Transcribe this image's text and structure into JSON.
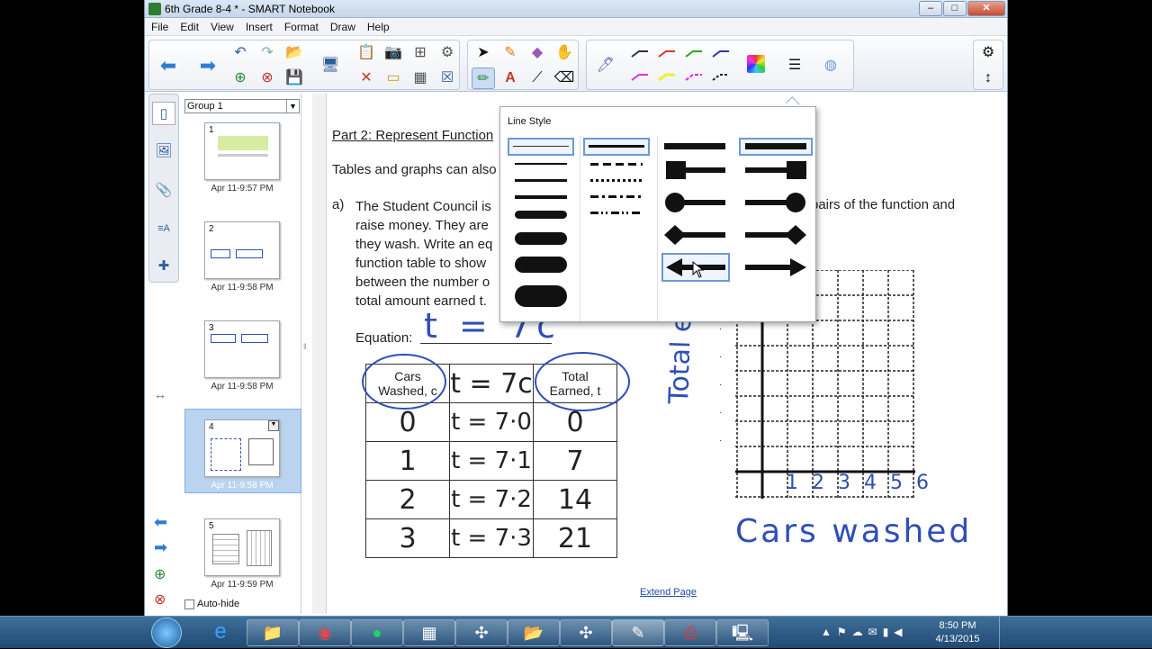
{
  "window": {
    "title": "6th Grade 8-4 * - SMART Notebook",
    "min": "–",
    "max": "□",
    "close": "✕"
  },
  "menu": [
    "File",
    "Edit",
    "View",
    "Insert",
    "Format",
    "Draw",
    "Help"
  ],
  "sorter": {
    "group_select": "Group 1",
    "thumbs": [
      {
        "num": "1",
        "date": "Apr 11-9:57 PM"
      },
      {
        "num": "2",
        "date": "Apr 11-9:58 PM"
      },
      {
        "num": "3",
        "date": "Apr 11-9:58 PM"
      },
      {
        "num": "4",
        "date": "Apr 11-9:58 PM"
      },
      {
        "num": "5",
        "date": "Apr 11-9:59 PM"
      }
    ],
    "autohide": "Auto-hide"
  },
  "popup": {
    "title": "Line Style"
  },
  "page": {
    "heading": "Part 2: Represent Function",
    "intro": "Tables and graphs can also",
    "item_label": "a)",
    "lines": [
      "The Student Council is",
      "raise money. They are",
      "they wash. Write an eq",
      "function table to show",
      "between the number o",
      "total amount earned t."
    ],
    "right_fragment": "pairs of the function and",
    "equation_label": "Equation:",
    "equation_hw": "t = 7c",
    "table": {
      "headers": [
        {
          "line1": "Cars",
          "line2": "Washed, c"
        },
        {
          "line1": "t = 7c",
          "line2": ""
        },
        {
          "line1": "Total",
          "line2": "Earned, t"
        }
      ],
      "rows": [
        [
          "0",
          "t = 7·0",
          "0"
        ],
        [
          "1",
          "t = 7·1",
          "7"
        ],
        [
          "2",
          "t = 7·2",
          "14"
        ],
        [
          "3",
          "t = 7·3",
          "21"
        ]
      ]
    },
    "y_axis_hw": "Total earned",
    "x_axis_ticks": "1 2 3 4 5 6",
    "x_axis_hw": "Cars washed",
    "extend": "Extend Page"
  },
  "clock": {
    "time": "8:50 PM",
    "date": "4/13/2015"
  },
  "colors": {
    "accent": "#2f4fb5",
    "selection": "#b9d3f0",
    "taskbar": "#2a5a85"
  }
}
